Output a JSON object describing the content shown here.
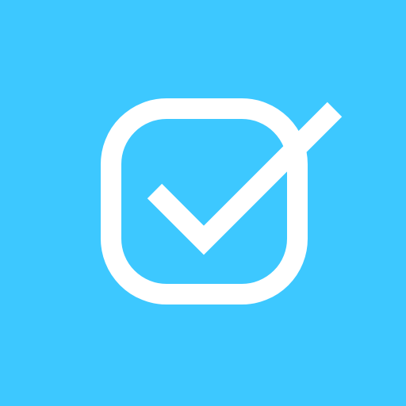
{
  "app_icon": {
    "icon": "checkbox-checked-icon",
    "background_color": "#3DC8FF",
    "foreground_color": "#FFFFFF"
  }
}
